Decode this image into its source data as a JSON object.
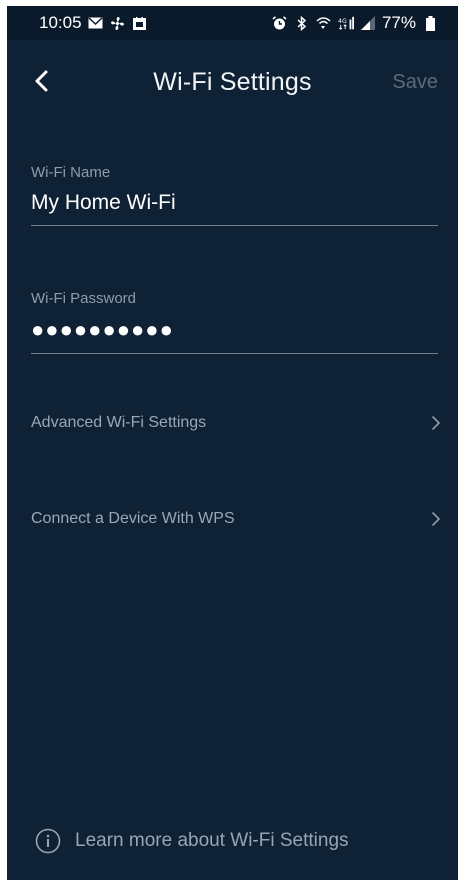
{
  "status_bar": {
    "time": "10:05",
    "battery": "77%",
    "left_icons": [
      "mail-icon",
      "fan-icon",
      "calendar-icon"
    ],
    "right_icons": [
      "alarm-icon",
      "bluetooth-icon",
      "wifi-call-icon",
      "lte-icon",
      "signal-icon",
      "battery-icon"
    ]
  },
  "header": {
    "title": "Wi-Fi Settings",
    "save_label": "Save",
    "back_icon": "chevron-left-icon"
  },
  "fields": {
    "wifi_name": {
      "label": "Wi-Fi Name",
      "value": "My Home Wi-Fi"
    },
    "wifi_password": {
      "label": "Wi-Fi Password",
      "value": "●●●●●●●●●●"
    }
  },
  "menu": [
    {
      "label": "Advanced Wi-Fi Settings",
      "icon": "chevron-right-icon"
    },
    {
      "label": "Connect a Device With WPS",
      "icon": "chevron-right-icon"
    }
  ],
  "footer": {
    "link_text": "Learn more about Wi-Fi Settings",
    "icon": "info-icon"
  },
  "colors": {
    "background": "#0f2135",
    "status_bar": "#0b1a2b",
    "save_disabled": "#5a6a7c",
    "label": "#8e9cab",
    "divider": "#6e7f92"
  }
}
